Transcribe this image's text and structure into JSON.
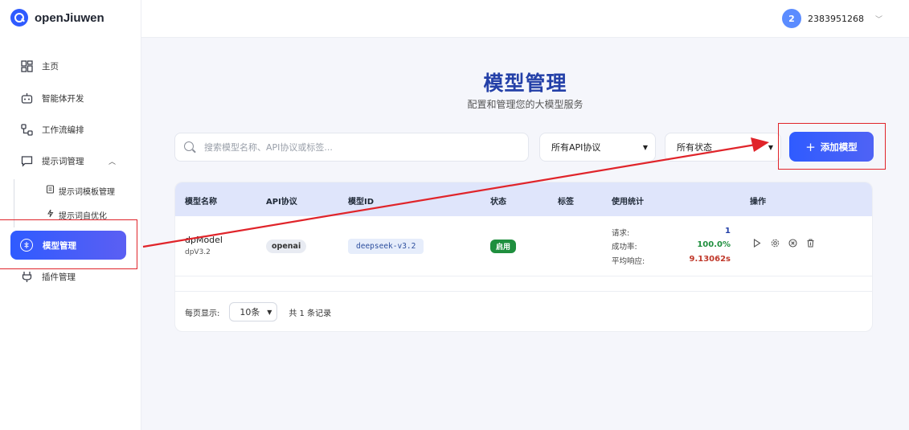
{
  "app": {
    "name": "openJiuwen"
  },
  "user": {
    "badge": "2",
    "name": "2383951268"
  },
  "sidebar": {
    "items": [
      {
        "label": "主页",
        "icon": "dashboard-icon"
      },
      {
        "label": "智能体开发",
        "icon": "robot-icon"
      },
      {
        "label": "工作流编排",
        "icon": "workflow-icon"
      },
      {
        "label": "提示词管理",
        "icon": "chat-icon",
        "expanded": true
      },
      {
        "label": "模型管理",
        "icon": "brain-icon",
        "active": true
      },
      {
        "label": "插件管理",
        "icon": "plug-icon"
      }
    ],
    "sub_items": [
      {
        "label": "提示词模板管理",
        "icon": "document-icon"
      },
      {
        "label": "提示词自优化",
        "icon": "sparkle-icon"
      }
    ]
  },
  "header": {
    "title": "模型管理",
    "subtitle": "配置和管理您的大模型服务"
  },
  "filters": {
    "search_placeholder": "搜索模型名称、API协议或标签...",
    "api_protocol": "所有API协议",
    "status": "所有状态",
    "add_button": "添加模型"
  },
  "table": {
    "columns": [
      "模型名称",
      "API协议",
      "模型ID",
      "状态",
      "标签",
      "使用统计",
      "操作"
    ],
    "rows": [
      {
        "name": "dpModel",
        "sub": "dpV3.2",
        "api": "openai",
        "model_id": "deepseek-v3.2",
        "status": "启用",
        "tags": "",
        "stats": {
          "requests_label": "请求:",
          "requests": "1",
          "success_label": "成功率:",
          "success": "100.0%",
          "latency_label": "平均响应:",
          "latency": "9.13062s"
        }
      }
    ]
  },
  "pagination": {
    "per_page_label": "每页显示:",
    "per_page": "10条",
    "total": "共 1 条记录"
  },
  "colors": {
    "accent": "#2f5bff",
    "title": "#2440a8",
    "annotation": "#e0242a",
    "success": "#1f8f3e"
  }
}
